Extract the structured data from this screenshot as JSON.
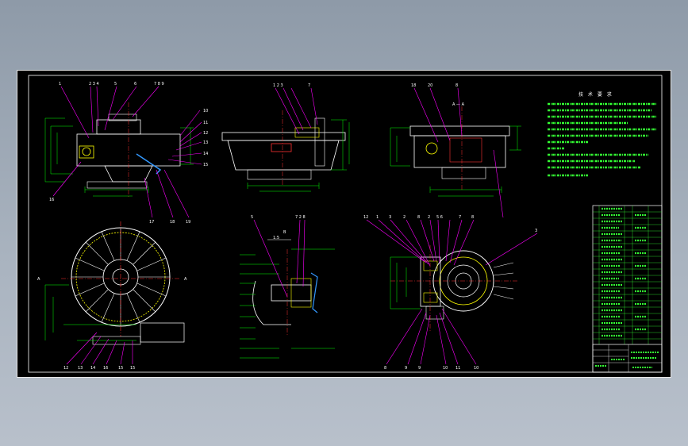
{
  "drawing": {
    "tech_title": "技 术 要 求",
    "section_label": "A — A",
    "scale_label": "1:5",
    "section_b_label": "B"
  },
  "colors": {
    "background": "#000000",
    "outline": "#ffffff",
    "dimension": "#00ff00",
    "leader": "#ff00ff",
    "centerline": "#ff3333",
    "hidden": "#3399ff",
    "table": "#33ff33"
  }
}
